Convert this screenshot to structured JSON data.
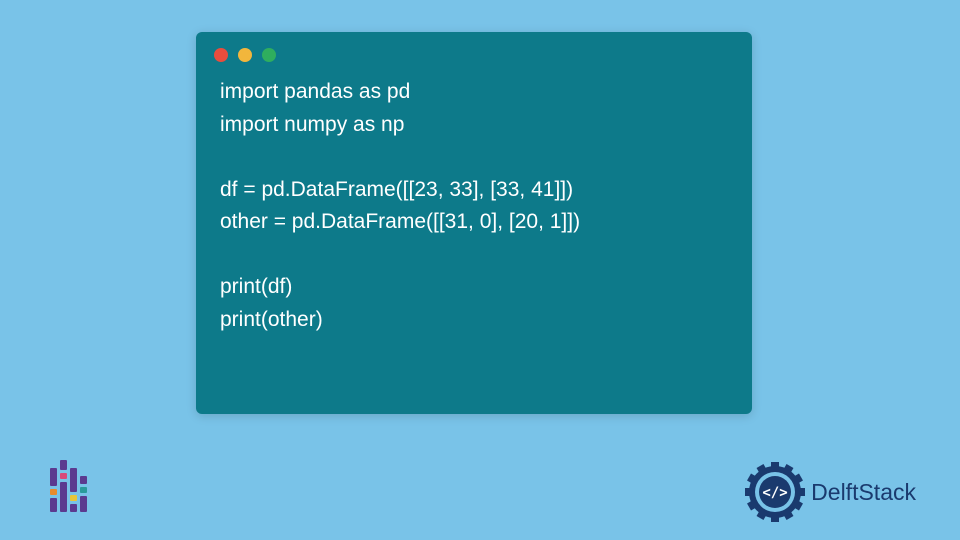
{
  "code": {
    "lines": [
      "import pandas as pd",
      "import numpy as np",
      "",
      "df = pd.DataFrame([[23, 33], [33, 41]])",
      "other = pd.DataFrame([[31, 0], [20, 1]])",
      "",
      "print(df)",
      "print(other)"
    ]
  },
  "window": {
    "dot_colors": [
      "#e84d3d",
      "#f2b63c",
      "#2fae5e"
    ]
  },
  "brand": {
    "name": "DelftStack"
  }
}
